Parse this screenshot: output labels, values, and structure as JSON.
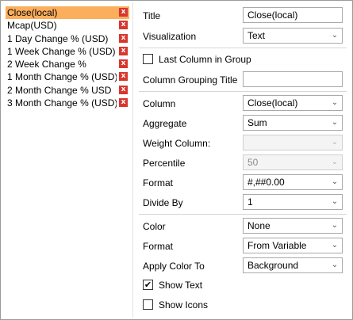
{
  "columns": [
    {
      "label": "Close(local)",
      "delete_icon": "x-icon"
    },
    {
      "label": "Mcap(USD)",
      "delete_icon": "x-icon"
    },
    {
      "label": "1 Day Change % (USD)",
      "delete_icon": "x-icon"
    },
    {
      "label": "1 Week Change % (USD)",
      "delete_icon": "x-icon"
    },
    {
      "label": "2 Week Change %",
      "delete_icon": "x-icon"
    },
    {
      "label": "1 Month Change % (USD)",
      "delete_icon": "x-icon"
    },
    {
      "label": "2 Month Change % USD",
      "delete_icon": "x-icon"
    },
    {
      "label": "3 Month Change % (USD)",
      "delete_icon": "x-icon"
    }
  ],
  "delete_glyph": "x",
  "selected_color": "#fbae5c",
  "delete_color": "#d9362e",
  "form": {
    "title": {
      "label": "Title",
      "value": "Close(local)"
    },
    "visualization": {
      "label": "Visualization",
      "value": "Text"
    },
    "last_column_in_group": {
      "label": "Last Column in Group",
      "checked": false,
      "mark": ""
    },
    "column_grouping_title": {
      "label": "Column Grouping Title",
      "value": ""
    },
    "column": {
      "label": "Column",
      "value": "Close(local)"
    },
    "aggregate": {
      "label": "Aggregate",
      "value": "Sum"
    },
    "weight_column": {
      "label": "Weight Column:",
      "value": ""
    },
    "percentile": {
      "label": "Percentile",
      "value": "50"
    },
    "format": {
      "label": "Format",
      "value": "#,##0.00"
    },
    "divide_by": {
      "label": "Divide By",
      "value": "1"
    },
    "color": {
      "label": "Color",
      "value": "None"
    },
    "color_format": {
      "label": "Format",
      "value": "From Variable"
    },
    "apply_color_to": {
      "label": "Apply Color To",
      "value": "Background"
    },
    "show_text": {
      "label": "Show Text",
      "checked": true,
      "mark": "✔"
    },
    "show_icons": {
      "label": "Show Icons",
      "checked": false,
      "mark": ""
    }
  },
  "chevron_glyph": "⌄"
}
